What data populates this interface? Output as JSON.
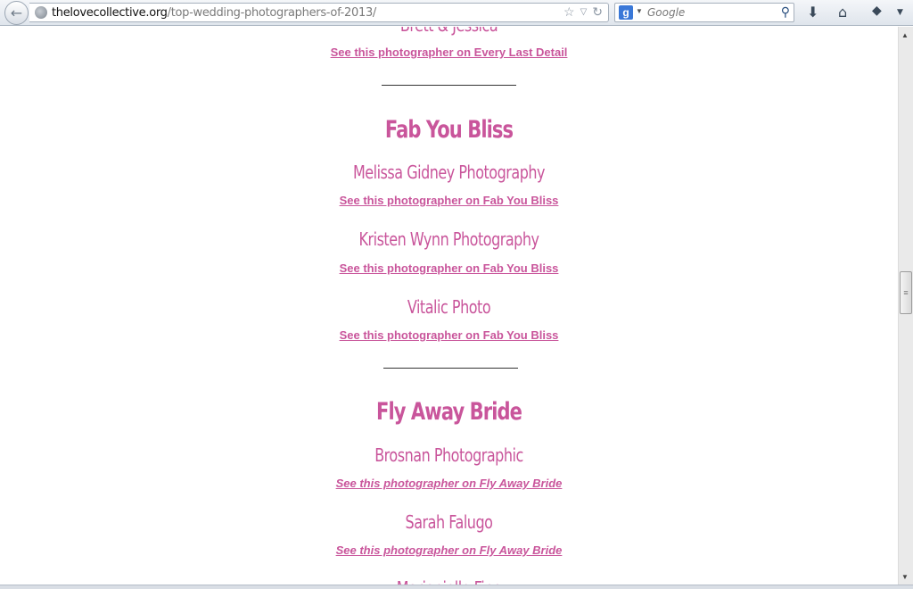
{
  "browser": {
    "url_domain": "thelovecollective.org",
    "url_path": "/top-wedding-photographers-of-2013/",
    "search_engine_letter": "g",
    "search_placeholder": "Google"
  },
  "page": {
    "cut_top_name": "Brett & Jessica",
    "cut_top_link": "See this photographer on Every Last Detail",
    "sections": [
      {
        "title": "Fab You Bliss",
        "photographers": [
          {
            "name": "Melissa Gidney Photography",
            "link": "See this photographer on Fab You Bliss"
          },
          {
            "name": "Kristen Wynn Photography",
            "link": "See this photographer on Fab You Bliss"
          },
          {
            "name": "Vitalic Photo",
            "link": "See this photographer on Fab You Bliss"
          }
        ]
      },
      {
        "title": "Fly Away Bride",
        "photographers": [
          {
            "name": "Brosnan Photographic",
            "link": "See this photographer on Fly Away Bride"
          },
          {
            "name": "Sarah Falugo",
            "link": "See this photographer on Fly Away Bride"
          }
        ]
      }
    ],
    "cut_bottom_name": "Marianielle Fine"
  },
  "colors": {
    "accent": "#c9559b"
  }
}
